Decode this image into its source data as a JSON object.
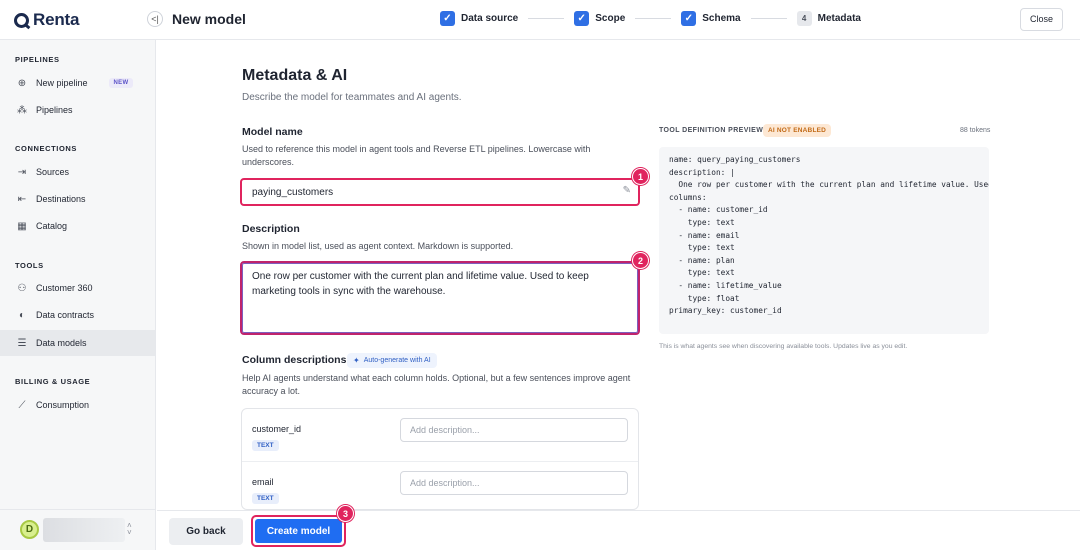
{
  "app": {
    "logo_text": "Renta"
  },
  "header": {
    "collapse_icon": "collapse-left-icon",
    "title": "New model",
    "steps": [
      {
        "label": "Data source",
        "state": "done"
      },
      {
        "label": "Scope",
        "state": "done"
      },
      {
        "label": "Schema",
        "state": "done"
      },
      {
        "number": "4",
        "label": "Metadata",
        "state": "current"
      }
    ],
    "close_label": "Close"
  },
  "sidebar": {
    "sections": [
      {
        "title": "PIPELINES"
      },
      {
        "title": "CONNECTIONS"
      },
      {
        "title": "TOOLS"
      },
      {
        "title": "BILLING & USAGE"
      }
    ],
    "items": [
      {
        "label": "New pipeline",
        "icon": "plus-circle-icon",
        "badge": "NEW"
      },
      {
        "label": "Pipelines",
        "icon": "pipelines-icon"
      },
      {
        "label": "Sources",
        "icon": "source-icon"
      },
      {
        "label": "Destinations",
        "icon": "destination-icon"
      },
      {
        "label": "Catalog",
        "icon": "catalog-icon"
      },
      {
        "label": "Customer 360",
        "icon": "user-icon"
      },
      {
        "label": "Data contracts",
        "icon": "shield-icon"
      },
      {
        "label": "Data models",
        "icon": "database-icon",
        "active": true
      },
      {
        "label": "Consumption",
        "icon": "chart-icon"
      }
    ],
    "user": {
      "avatar_letter": "D",
      "name": ""
    }
  },
  "main": {
    "title": "Metadata & AI",
    "subtitle": "Describe the model for teammates and AI agents.",
    "model_name": {
      "label": "Model name",
      "help": "Used to reference this model in agent tools and Reverse ETL pipelines. Lowercase with underscores.",
      "value": "paying_customers"
    },
    "description": {
      "label": "Description",
      "help": "Shown in model list, used as agent context. Markdown is supported.",
      "value": "One row per customer with the current plan and lifetime value. Used to keep marketing tools in sync with the warehouse."
    },
    "columns": {
      "label": "Column descriptions",
      "ai_button": "Auto-generate with AI",
      "help": "Help AI agents understand what each column holds. Optional, but a few sentences improve agent accuracy a lot.",
      "rows": [
        {
          "name": "customer_id",
          "type": "TEXT",
          "placeholder": "Add description..."
        },
        {
          "name": "email",
          "type": "TEXT",
          "placeholder": "Add description..."
        }
      ]
    }
  },
  "preview": {
    "title": "TOOL DEFINITION PREVIEW",
    "badge": "AI NOT ENABLED",
    "tokens": "88 tokens",
    "code": "name: query_paying_customers\ndescription: |\n  One row per customer with the current plan and lifetime value. Used to keep marketing tools in sync with the warehouse.\ncolumns:\n  - name: customer_id\n    type: text\n  - name: email\n    type: text\n  - name: plan\n    type: text\n  - name: lifetime_value\n    type: float\nprimary_key: customer_id",
    "note": "This is what agents see when discovering available tools. Updates live as you edit."
  },
  "footer": {
    "back_label": "Go back",
    "create_label": "Create model"
  },
  "markers": [
    "1",
    "2",
    "3"
  ],
  "colors": {
    "accent": "#1f6df2",
    "highlight": "#e0245e",
    "step_done": "#2f6fe4"
  }
}
